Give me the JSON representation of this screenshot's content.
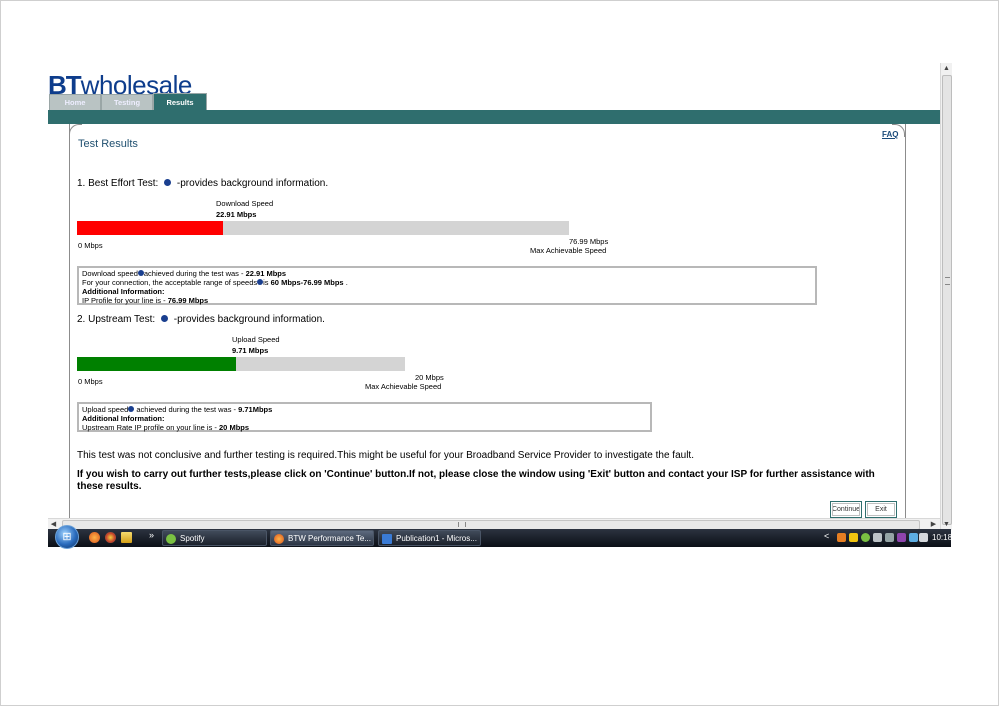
{
  "header": {
    "logo_bt": "BT",
    "logo_wholesale": "wholesale",
    "tabs": [
      {
        "label": "Home",
        "active": false
      },
      {
        "label": "Testing",
        "active": false
      },
      {
        "label": "Results",
        "active": true
      }
    ],
    "faq_label": "FAQ"
  },
  "page_title": "Test Results",
  "best_effort": {
    "heading_prefix": "1. Best Effort Test:",
    "heading_suffix": "-provides background information.",
    "speed_label": "Download Speed",
    "speed_value": "22.91 Mbps",
    "min_label": "0 Mbps",
    "max_value_label": "76.99 Mbps",
    "max_caption": "Max Achievable Speed",
    "measured_mbps": 22.91,
    "max_mbps": 76.99,
    "bar_color": "#ff0000",
    "info": {
      "line1_a": "Download speed",
      "line1_b": "achieved during the test was -",
      "line1_value": "22.91 Mbps",
      "line2_a": "For your connection, the acceptable range of speeds",
      "line2_b": "is",
      "line2_value": "60 Mbps-76.99 Mbps",
      "line2_end": ".",
      "line3": "Additional Information:",
      "line4_a": "IP Profile for your line is -",
      "line4_value": "76.99 Mbps"
    }
  },
  "upstream": {
    "heading_prefix": "2. Upstream Test:",
    "heading_suffix": "-provides background information.",
    "speed_label": "Upload Speed",
    "speed_value": "9.71 Mbps",
    "min_label": "0 Mbps",
    "max_value_label": "20 Mbps",
    "max_caption": "Max Achievable Speed",
    "measured_mbps": 9.71,
    "max_mbps": 20,
    "bar_color": "#008000",
    "info": {
      "line1_a": "Upload speed",
      "line1_b": "achieved during the test was -",
      "line1_value": "9.71Mbps",
      "line2": "Additional Information:",
      "line3_a": "Upstream Rate IP profile on your line is -",
      "line3_value": "20 Mbps"
    }
  },
  "messages": {
    "inconclusive": "This test was not conclusive and further testing is required.This might be useful for your Broadband Service Provider to investigate the fault.",
    "instructions": "If you wish to carry out further tests,please click on 'Continue' button.If not, please close the window using 'Exit' button and contact your ISP for further assistance with these results."
  },
  "buttons": {
    "continue_label": "Continue",
    "exit_label": "Exit"
  },
  "taskbar": {
    "overflow_label": "»",
    "items": [
      {
        "label": "Spotify",
        "active": false,
        "icon": "spotify-icon"
      },
      {
        "label": "BTW Performance Te...",
        "active": true,
        "icon": "firefox-icon"
      },
      {
        "label": "Publication1 - Micros...",
        "active": false,
        "icon": "publisher-icon"
      }
    ],
    "tray_chevron": "<",
    "clock": "10:18"
  },
  "colors": {
    "brand_blue": "#0e3d8c",
    "teal": "#2f6e6e",
    "bar_track": "#d4d4d4"
  }
}
